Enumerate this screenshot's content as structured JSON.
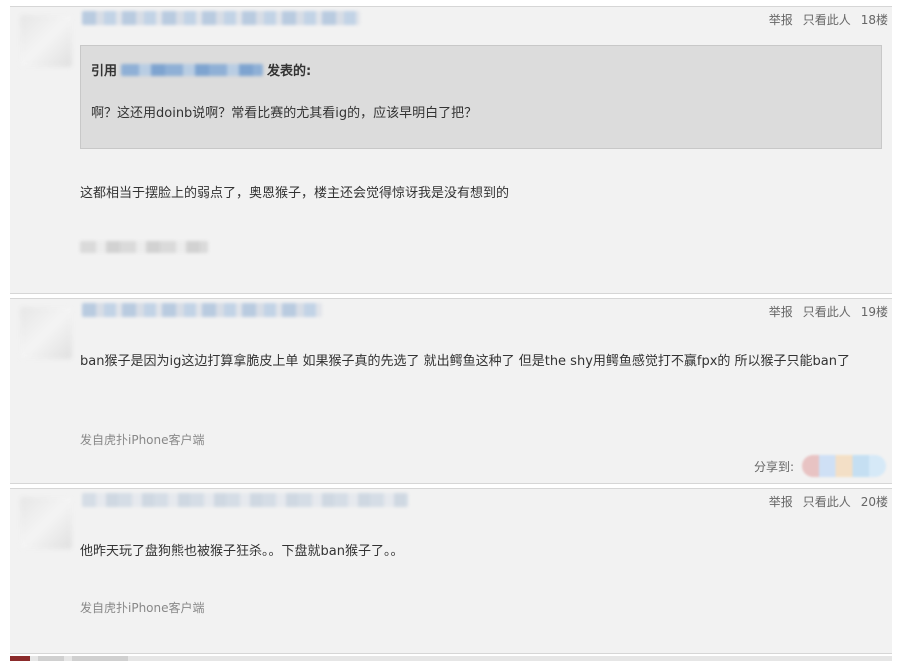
{
  "posts": [
    {
      "floor": "18楼",
      "report_label": "举报",
      "only_label": "只看此人",
      "quote": {
        "prefix": "引用",
        "suffix": "发表的:",
        "text": "啊？这还用doinb说啊？常看比赛的尤其看ig的，应该早明白了把？"
      },
      "body": "这都相当于摆脸上的弱点了，奥恩猴子，楼主还会觉得惊讶我是没有想到的"
    },
    {
      "floor": "19楼",
      "report_label": "举报",
      "only_label": "只看此人",
      "body": "ban猴子是因为ig这边打算拿脆皮上单 如果猴子真的先选了 就出鳄鱼这种了 但是the shy用鳄鱼感觉打不赢fpx的 所以猴子只能ban了",
      "source": "发自虎扑iPhone客户端",
      "share_label": "分享到:"
    },
    {
      "floor": "20楼",
      "report_label": "举报",
      "only_label": "只看此人",
      "body": "他昨天玩了盘狗熊也被猴子狂杀。。下盘就ban猴子了。。",
      "source": "发自虎扑iPhone客户端"
    }
  ]
}
